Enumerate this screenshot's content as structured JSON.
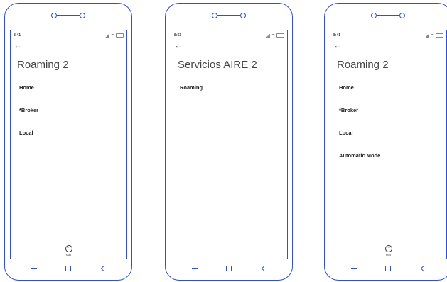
{
  "phones": [
    {
      "time": "8:41",
      "back_glyph": "←",
      "title": "Roaming 2",
      "items": [
        "Home",
        "*Broker",
        "Local"
      ],
      "more_label": "Más",
      "more_glyph": "⋯"
    },
    {
      "time": "8:53",
      "back_glyph": "←",
      "title": "Servicios AIRE 2",
      "items": [
        "Roaming"
      ]
    },
    {
      "time": "8:41",
      "back_glyph": "←",
      "title": "Roaming 2",
      "items": [
        "Home",
        "*Broker",
        "Local",
        "Automatic Mode"
      ],
      "more_label": "Más",
      "more_glyph": "⋯"
    }
  ],
  "colors": {
    "frame": "#2f4de0",
    "text": "#222222",
    "title": "#444444"
  },
  "icons": {
    "back": "arrow-left-icon",
    "more": "more-horizontal-icon",
    "nav": [
      "menu-icon",
      "square-icon",
      "chevron-left-icon"
    ]
  }
}
